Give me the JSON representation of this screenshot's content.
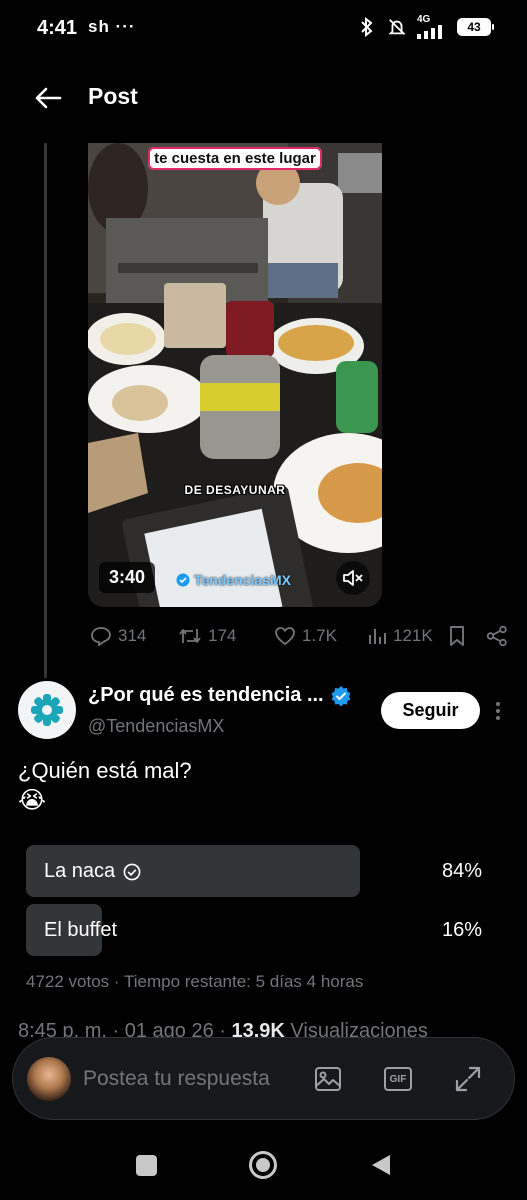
{
  "status_bar": {
    "time": "4:41",
    "left_icons": "sh ···",
    "network": "4G",
    "battery": "43",
    "icons": [
      "bluetooth-icon",
      "silent-icon",
      "signal-icon"
    ]
  },
  "header": {
    "back_icon": "arrow-left-icon",
    "title": "Post"
  },
  "video": {
    "caption_top": "te cuesta en este lugar",
    "caption_mid": "DE DESAYUNAR",
    "duration": "3:40",
    "watermark": "TendenciasMX",
    "mute_icon": "muted-speaker-icon"
  },
  "engagement": {
    "replies": "314",
    "reposts": "174",
    "likes": "1.7K",
    "views": "121K"
  },
  "account": {
    "name": "¿Por qué es tendencia ...",
    "handle": "@TendenciasMX",
    "verified": true,
    "follow_label": "Seguir"
  },
  "tweet": {
    "text": "¿Quién está mal?",
    "emoji": "😭"
  },
  "poll": {
    "options": [
      {
        "label": "La naca",
        "percent": "84%",
        "share": 0.84,
        "winner": true
      },
      {
        "label": "El buffet",
        "percent": "16%",
        "share": 0.16,
        "winner": false
      }
    ],
    "meta": "4722 votos · Tiempo restante: 5 días 4 horas"
  },
  "meta": {
    "time": "8:45 p. m.",
    "date": "01 ago 26",
    "views_count": "13.9K",
    "views_label": "Visualizaciones"
  },
  "composer": {
    "placeholder": "Postea tu respuesta",
    "gif_label": "GIF"
  },
  "colors": {
    "background": "#000000",
    "muted": "#71767b",
    "poll_bar": "#333639",
    "verified": "#1d9bf0"
  }
}
